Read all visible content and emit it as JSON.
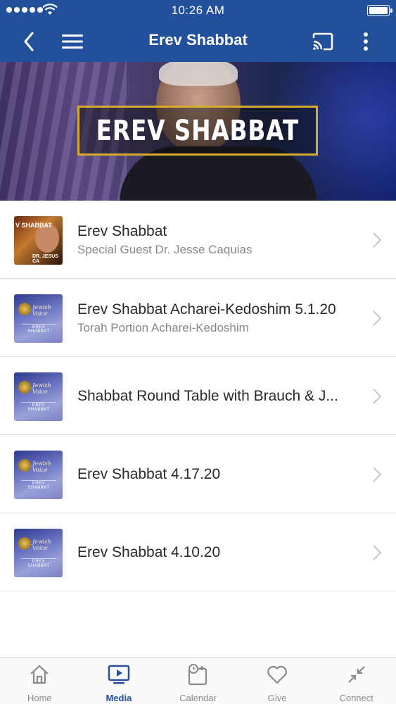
{
  "status_bar": {
    "time": "10:26 AM"
  },
  "nav": {
    "title": "Erev Shabbat",
    "icons": [
      "back-chevron-icon",
      "hamburger-menu-icon",
      "cast-icon",
      "more-vertical-icon"
    ]
  },
  "hero": {
    "banner_text": "EREV SHABBAT"
  },
  "items": [
    {
      "title": "Erev Shabbat",
      "subtitle": "Special Guest Dr. Jesse Caquias",
      "thumb_label_top": "V SHABBAT",
      "thumb_label_bottom": "DR. JESUS CA"
    },
    {
      "title": "Erev Shabbat Acharei-Kedoshim 5.1.20",
      "subtitle": "Torah Portion Acharei-Kedoshim",
      "thumb_label": "EREV SHABBAT"
    },
    {
      "title": "Shabbat Round Table with Brauch & J...",
      "subtitle": "",
      "thumb_label": "EREV SHABBAT"
    },
    {
      "title": "Erev Shabbat 4.17.20",
      "subtitle": "",
      "thumb_label": "EREV SHABBAT"
    },
    {
      "title": "Erev Shabbat 4.10.20",
      "subtitle": "",
      "thumb_label": "EREV SHABBAT"
    }
  ],
  "tabs": [
    {
      "label": "Home",
      "icon": "home-icon",
      "active": false
    },
    {
      "label": "Media",
      "icon": "media-tv-icon",
      "active": true
    },
    {
      "label": "Calendar",
      "icon": "calendar-icon",
      "active": false
    },
    {
      "label": "Give",
      "icon": "heart-icon",
      "active": false
    },
    {
      "label": "Connect",
      "icon": "connect-arrows-icon",
      "active": false
    }
  ],
  "colors": {
    "brand_blue": "#23509c",
    "banner_border": "#d6aa2c",
    "inactive_tab": "#8a8a8a"
  }
}
